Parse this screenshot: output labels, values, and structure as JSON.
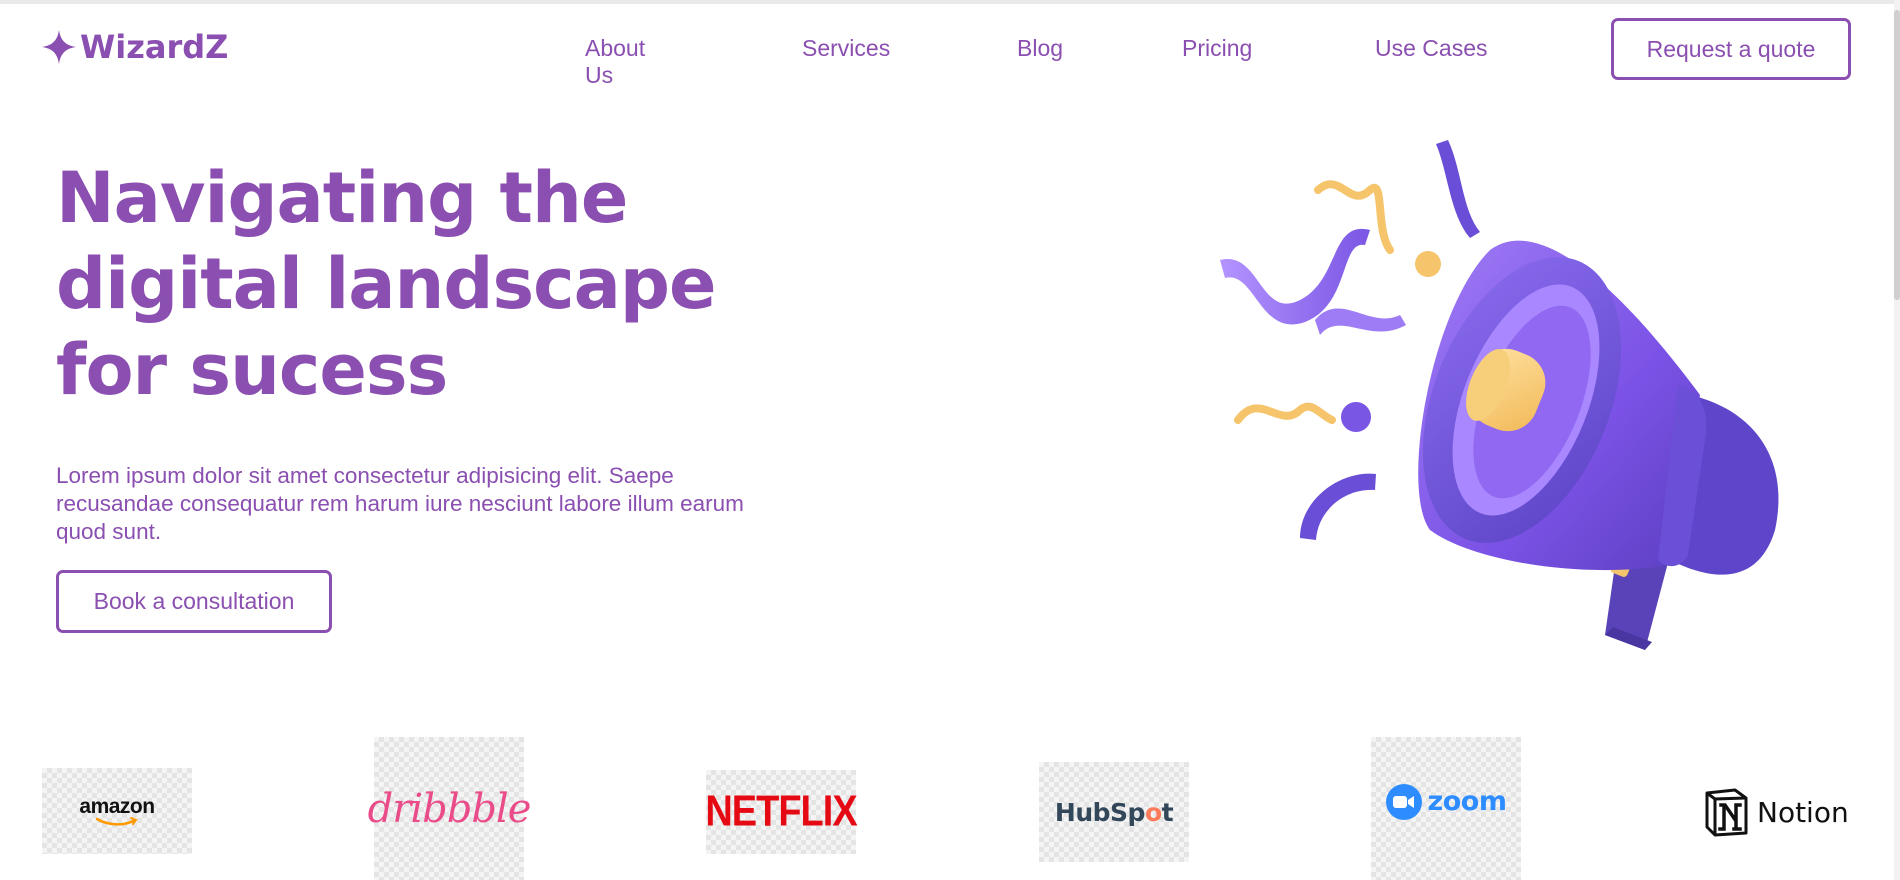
{
  "header": {
    "logo_text": "WizardZ",
    "nav": [
      "About Us",
      "Services",
      "Blog",
      "Pricing",
      "Use Cases"
    ],
    "cta_label": "Request a quote"
  },
  "hero": {
    "title_lines": [
      "Navigating the",
      "digital landscape",
      "for sucess"
    ],
    "description": "Lorem ipsum dolor sit amet consectetur adipisicing elit. Saepe recusandae consequatur rem harum iure nesciunt labore illum earum quod sunt.",
    "button_label": "Book a consultation",
    "illustration": "megaphone-illustration"
  },
  "brands": {
    "amazon": "amazon",
    "dribbble": "dribbble",
    "netflix": "NETFLIX",
    "hubspot_pre": "HubSp",
    "hubspot_o": "o",
    "hubspot_post": "t",
    "zoom": "zoom",
    "notion": "Notion"
  },
  "colors": {
    "brand_purple": "#8a4fb0",
    "megaphone": "#7b52e6",
    "accent_yellow": "#f5c46b"
  }
}
